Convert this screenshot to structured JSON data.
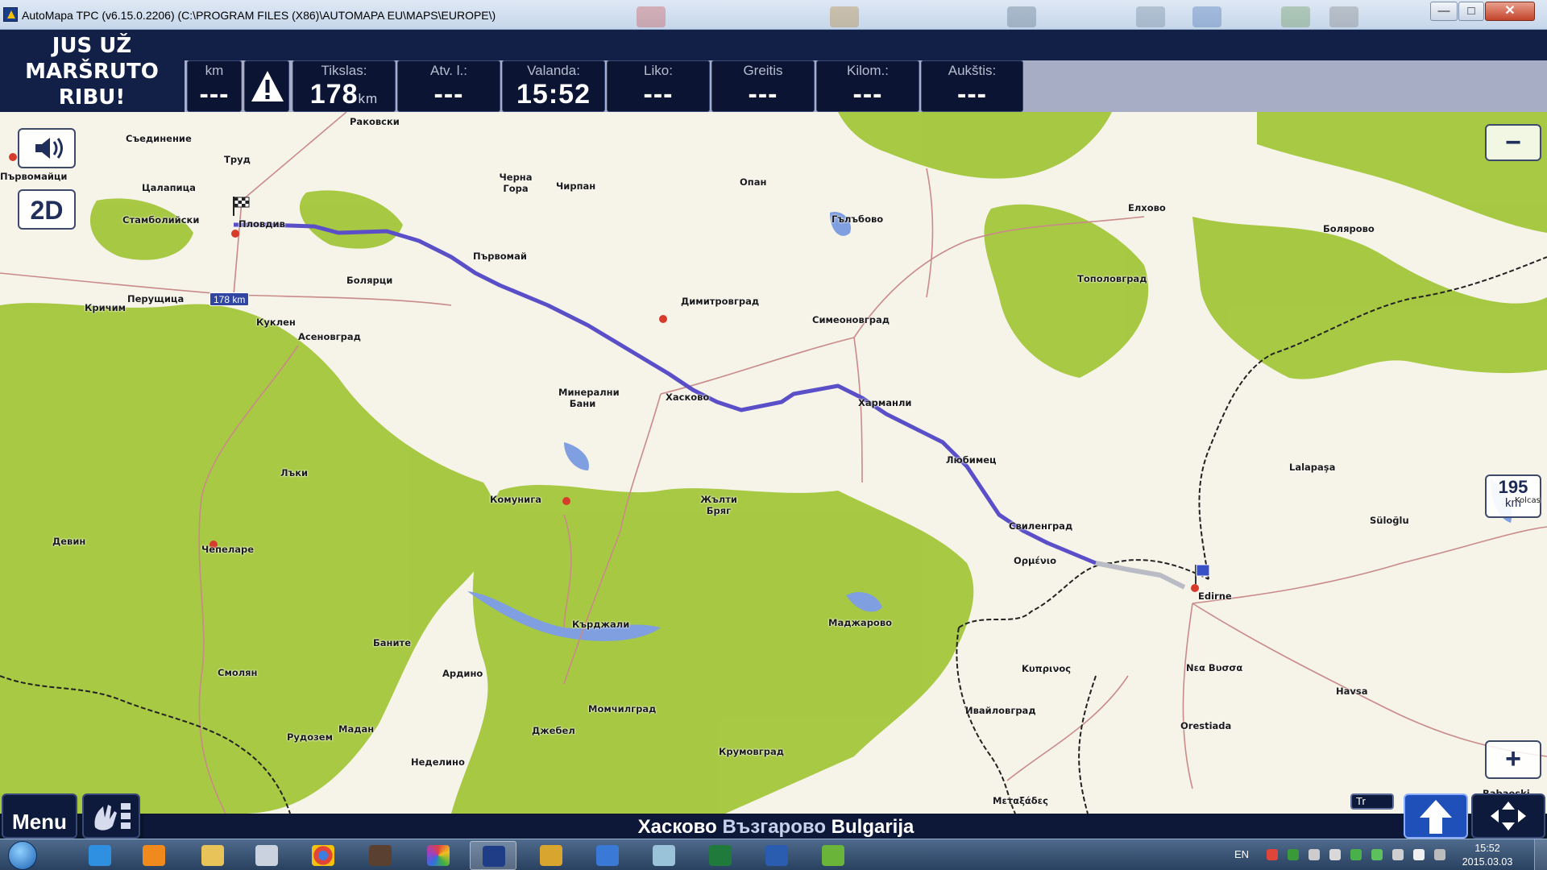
{
  "window": {
    "title": "AutoMapa TPC (v6.15.0.2206) (C:\\PROGRAM FILES (X86)\\AUTOMAPA EU\\MAPS\\EUROPE\\)",
    "minimize_glyph": "—",
    "maximize_glyph": "□",
    "close_glyph": "✕"
  },
  "nav": {
    "message": "JUS UŽ\nMARŠRUTO\nRIBU!",
    "warning_icon": "warning-icon",
    "panels": [
      {
        "label": "km",
        "value": "---",
        "unit": ""
      },
      {
        "label": "Tikslas:",
        "value": "178",
        "unit": "km"
      },
      {
        "label": "Atv. l.:",
        "value": "---",
        "unit": ""
      },
      {
        "label": "Valanda:",
        "value": "15:52",
        "unit": ""
      },
      {
        "label": "Liko:",
        "value": "---",
        "unit": ""
      },
      {
        "label": "Greitis",
        "value": "---",
        "unit": ""
      },
      {
        "label": "Kilom.:",
        "value": "---",
        "unit": ""
      },
      {
        "label": "Aukštis:",
        "value": "---",
        "unit": ""
      }
    ]
  },
  "map": {
    "mode_label": "2D",
    "zoom_out": "−",
    "zoom_in": "+",
    "distance_badge": {
      "value": "195",
      "unit": "km"
    },
    "distance_side_text": "Kolcas",
    "route_distance": "178 km",
    "cities": [
      "Раковски",
      "Съединение",
      "Труд",
      "Черна Гора",
      "Чирпан",
      "Опан",
      "Цалапица",
      "Стамболийски",
      "Пловдив",
      "Първомай",
      "Гълъбово",
      "Елхово",
      "Болярово",
      "Перущица",
      "Кричим",
      "Куклен",
      "Асеновград",
      "Болярци",
      "Димитровград",
      "Симеоновград",
      "Тополовград",
      "Хасково",
      "Минерални Бани",
      "Харманли",
      "Любимец",
      "Свиленград",
      "Lalapaşa",
      "Süloğlu",
      "Ορμένιο",
      "Edirne",
      "Лъки",
      "Комунига",
      "Жълти Бряг",
      "Девин",
      "Чепеларе",
      "Смолян",
      "Баните",
      "Кърджали",
      "Маджарово",
      "Ардино",
      "Момчилград",
      "Рудозем",
      "Мадан",
      "Джебел",
      "Неделино",
      "Крумовград",
      "Ивайловград",
      "Κυπρινος",
      "Νεα Βυσσα",
      "Orestiada",
      "Μεταξάδες",
      "Havsa",
      "Babaeski",
      "Първомайци"
    ]
  },
  "bottom": {
    "menu_label": "Menu",
    "street_parts": [
      "Хасково",
      "Възгарово",
      "Bulgarija"
    ],
    "tr_label": "Tr"
  },
  "taskbar": {
    "lang": "EN",
    "time": "15:52",
    "date": "2015.03.03"
  },
  "colors": {
    "header_bg": "#122048",
    "panel_bg": "#0b1533",
    "route": "#5a4fc8",
    "forest": "#9fc230",
    "water": "#7f9fe0",
    "border": "#222222"
  }
}
